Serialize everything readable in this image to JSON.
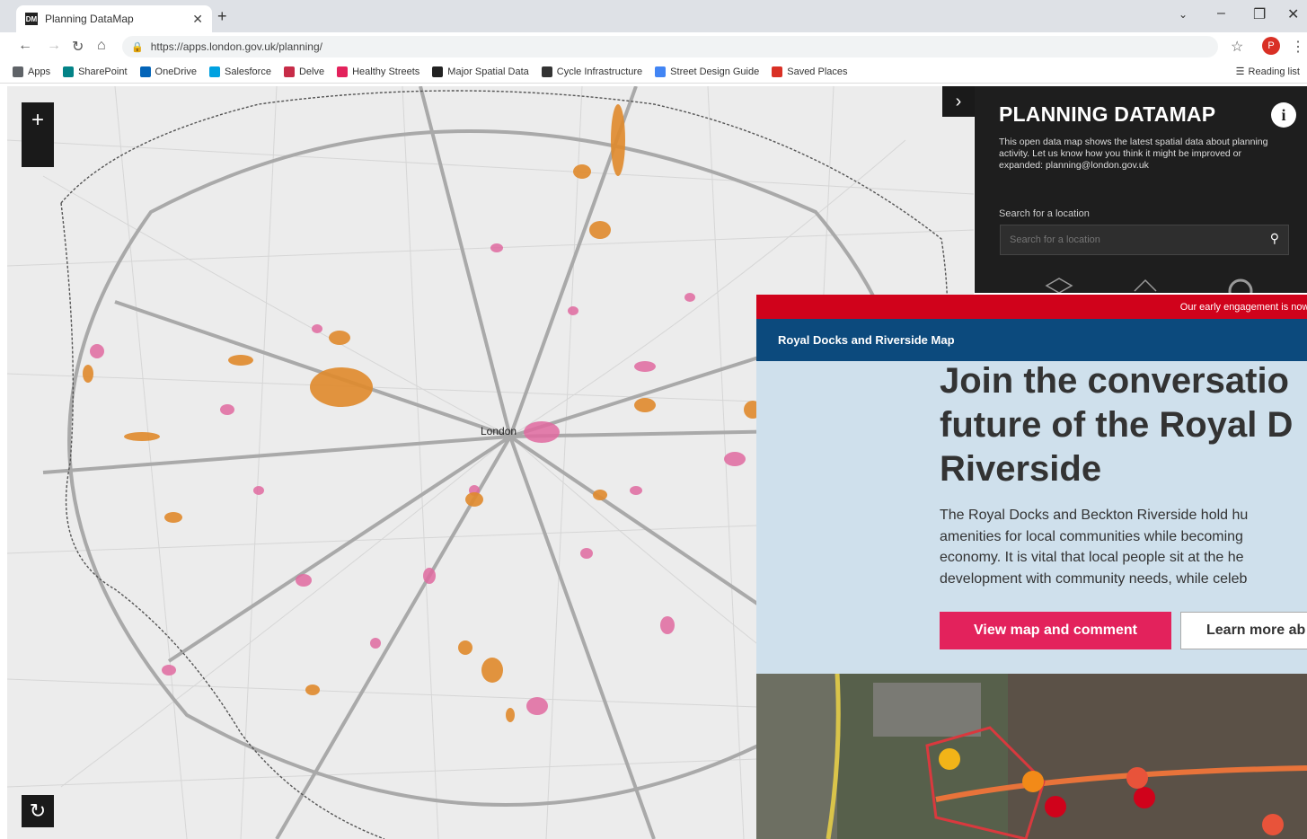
{
  "browser": {
    "tab_title": "Planning DataMap",
    "tab_favicon_text": "DM",
    "url": "https://apps.london.gov.uk/planning/",
    "profile_initial": "P",
    "bookmarks": [
      {
        "label": "Apps",
        "color": "#5f6368"
      },
      {
        "label": "SharePoint",
        "color": "#038387"
      },
      {
        "label": "OneDrive",
        "color": "#0364b8"
      },
      {
        "label": "Salesforce",
        "color": "#00a1e0"
      },
      {
        "label": "Delve",
        "color": "#c72c48"
      },
      {
        "label": "Healthy Streets",
        "color": "#e3225c"
      },
      {
        "label": "Major Spatial Data",
        "color": "#222222"
      },
      {
        "label": "Cycle Infrastructure",
        "color": "#333333"
      },
      {
        "label": "Street Design Guide",
        "color": "#4285f4"
      },
      {
        "label": "Saved Places",
        "color": "#d93025"
      }
    ],
    "reading_list": "Reading list"
  },
  "map": {
    "city_label": "London"
  },
  "panel": {
    "title": "PLANNING DATAMAP",
    "description": "This open data map shows the latest spatial data about planning activity. Let us know how you think it might be improved or expanded: planning@london.gov.uk",
    "search_label": "Search for a location",
    "search_placeholder": "Search for a location"
  },
  "website": {
    "alert": "Our early engagement is now open",
    "nav_title": "Royal Docks and Riverside Map",
    "hero_title": "Join the conversatio\nfuture of the Royal D\nRiverside",
    "hero_body": "The Royal Docks and Beckton Riverside hold hu\namenities for local communities while becoming\neconomy. It is vital that local people sit at the he\ndevelopment with community needs, while celeb",
    "cta_primary": "View map and comment",
    "cta_secondary": "Learn more ab"
  },
  "colors": {
    "opportunity": "#e08a2c",
    "town_centre": "#e06aa0",
    "brand_pink": "#e3225c",
    "nav_blue": "#0c4a7d",
    "alert_red": "#d0021b"
  }
}
